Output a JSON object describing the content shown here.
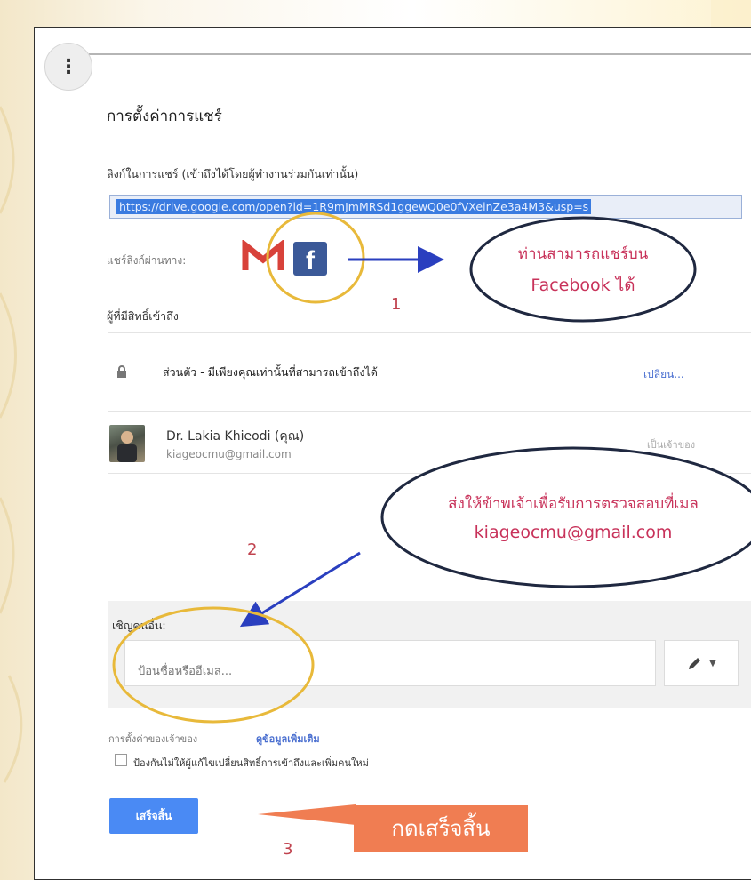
{
  "dialog": {
    "title": "การตั้งค่าการแชร์",
    "link_label": "ลิงก์ในการแชร์ (เข้าถึงได้โดยผู้ทำงานร่วมกันเท่านั้น)",
    "share_link": "https://drive.google.com/open?id=1R9mJmMRSd1ggewQ0e0fVXeinZe3a4M3&usp=s",
    "share_via_label": "แชร์ลิงก์ผ่านทาง:",
    "share_icons": [
      "gmail-icon",
      "facebook-icon"
    ],
    "who_has_access_label": "ผู้ที่มีสิทธิ์เข้าถึง",
    "access_level_text": "ส่วนตัว - มีเพียงคุณเท่านั้นที่สามารถเข้าถึงได้",
    "change_link": "เปลี่ยน...",
    "owner": {
      "name": "Dr. Lakia Khieodi (คุณ)",
      "email": "kiageocmu@gmail.com",
      "role": "เป็นเจ้าของ"
    },
    "invite_label": "เชิญคนอื่น:",
    "invite_placeholder": "ป้อนชื่อหรืออีเมล...",
    "owner_settings_label": "การตั้งค่าของเจ้าของ",
    "more_info_link": "ดูข้อมูลเพิ่มเติม",
    "checkbox_label": "ป้องกันไม่ให้ผู้แก้ไขเปลี่ยนสิทธิ์การเข้าถึงและเพิ่มคนใหม่",
    "checkbox_checked": false,
    "done_button": "เสร็จสิ้น"
  },
  "annotations": {
    "facebook_note_line1": "ท่านสามารถแชร์บน",
    "facebook_note_line2": "Facebook ได้",
    "email_note_line1": "ส่งให้ข้าพเจ้าเพื่อรับการตรวจสอบที่เมล",
    "email_note_line2": "kiageocmu@gmail.com",
    "step1": "1",
    "step2": "2",
    "step3": "3",
    "done_callout": "กดเสร็จสิ้น"
  },
  "colors": {
    "annotation_text": "#c8325a",
    "ellipse_outline": "#1f2840",
    "highlight_circle": "#e8b93a",
    "arrow": "#2a3fbf",
    "callout": "#f07d52",
    "primary_button": "#4a8af4"
  }
}
